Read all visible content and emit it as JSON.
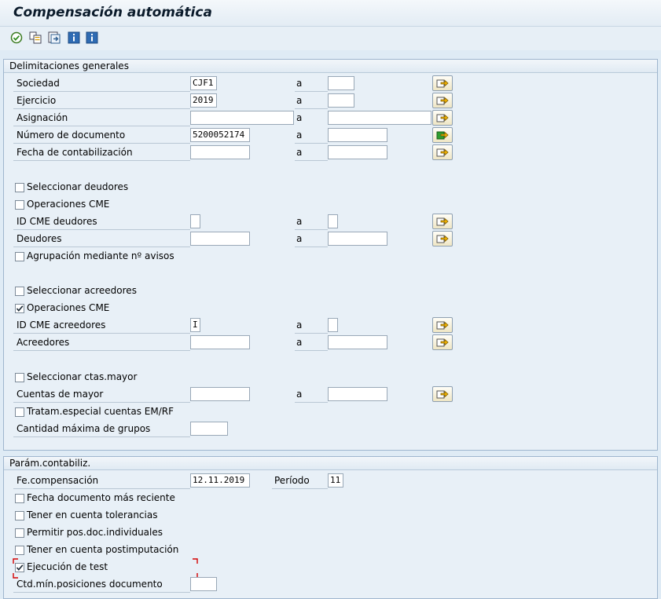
{
  "window": {
    "title": "Compensación automática"
  },
  "toolbar": {
    "icons": [
      "execute-icon",
      "variant-icon",
      "get-variant-icon",
      "info-icon",
      "info-icon-2"
    ]
  },
  "general": {
    "title": "Delimitaciones generales",
    "to_label": "a",
    "sociedad": {
      "label": "Sociedad",
      "value": "CJF1"
    },
    "ejercicio": {
      "label": "Ejercicio",
      "value": "2019"
    },
    "asignacion": {
      "label": "Asignación",
      "value": ""
    },
    "numero_doc": {
      "label": "Número de documento",
      "value": "5200052174"
    },
    "fecha_cont": {
      "label": "Fecha de contabilización",
      "value": ""
    },
    "sel_deudores": {
      "label": "Seleccionar deudores",
      "checked": false
    },
    "ops_cme_deud": {
      "label": "Operaciones CME",
      "checked": false
    },
    "id_cme_deud": {
      "label": "ID CME deudores",
      "value": ""
    },
    "deudores": {
      "label": "Deudores",
      "value": ""
    },
    "agrupacion": {
      "label": "Agrupación mediante nº avisos",
      "checked": false
    },
    "sel_acreedores": {
      "label": "Seleccionar acreedores",
      "checked": false
    },
    "ops_cme_acr": {
      "label": "Operaciones CME",
      "checked": true
    },
    "id_cme_acr": {
      "label": "ID CME acreedores",
      "value": "I"
    },
    "acreedores": {
      "label": "Acreedores",
      "value": ""
    },
    "sel_ctas": {
      "label": "Seleccionar ctas.mayor",
      "checked": false
    },
    "cuentas_mayor": {
      "label": "Cuentas de mayor",
      "value": ""
    },
    "tratam": {
      "label": "Tratam.especial cuentas EM/RF",
      "checked": false
    },
    "cant_max": {
      "label": "Cantidad máxima de grupos",
      "value": ""
    }
  },
  "posting": {
    "title": "Parám.contabiliz.",
    "fe_comp": {
      "label": "Fe.compensación",
      "value": "12.11.2019"
    },
    "periodo": {
      "label": "Período",
      "value": "11"
    },
    "fecha_doc": {
      "label": "Fecha documento más reciente",
      "checked": false
    },
    "tolerancias": {
      "label": "Tener en cuenta tolerancias",
      "checked": false
    },
    "permitir": {
      "label": "Permitir pos.doc.individuales",
      "checked": false
    },
    "postimp": {
      "label": "Tener en cuenta postimputación",
      "checked": false
    },
    "test": {
      "label": "Ejecución de test",
      "checked": true
    },
    "ctd_min": {
      "label": "Ctd.mín.posiciones documento",
      "value": ""
    }
  },
  "colors": {
    "background": "#dfebf5",
    "group_border": "#9fb6ce",
    "checkmark": "#1c2a36",
    "focus_corner": "#d40000"
  }
}
